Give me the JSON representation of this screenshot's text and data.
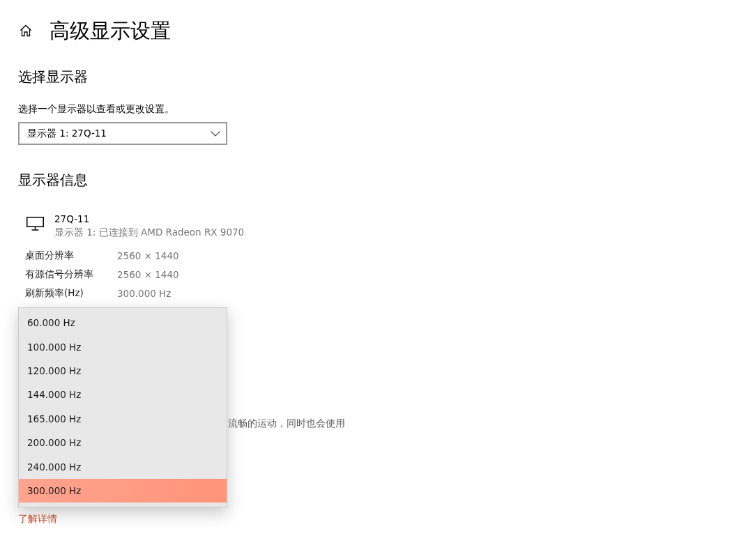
{
  "page": {
    "title": "高级显示设置"
  },
  "select_display": {
    "heading": "选择显示器",
    "description": "选择一个显示器以查看或更改设置。",
    "dropdown": {
      "value": "显示器 1: 27Q-11"
    }
  },
  "display_info": {
    "heading": "显示器信息",
    "monitor": {
      "name": "27Q-11",
      "connection": "显示器 1: 已连接到 AMD Radeon RX 9070"
    },
    "rows": [
      {
        "label": "桌面分辨率",
        "value": "2560 × 1440"
      },
      {
        "label": "有源信号分辨率",
        "value": "2560 × 1440"
      },
      {
        "label": "刷新频率(Hz)",
        "value": "300.000 Hz"
      }
    ]
  },
  "refresh_rate": {
    "description_fragment": "流畅的运动，同时也会使用",
    "link": "了解详情",
    "options_menu": {
      "options": [
        {
          "label": "60.000 Hz",
          "selected": false
        },
        {
          "label": "100.000 Hz",
          "selected": false
        },
        {
          "label": "120.000 Hz",
          "selected": false
        },
        {
          "label": "144.000 Hz",
          "selected": false
        },
        {
          "label": "165.000 Hz",
          "selected": false
        },
        {
          "label": "200.000 Hz",
          "selected": false
        },
        {
          "label": "240.000 Hz",
          "selected": false
        },
        {
          "label": "300.000 Hz",
          "selected": true
        }
      ]
    }
  }
}
